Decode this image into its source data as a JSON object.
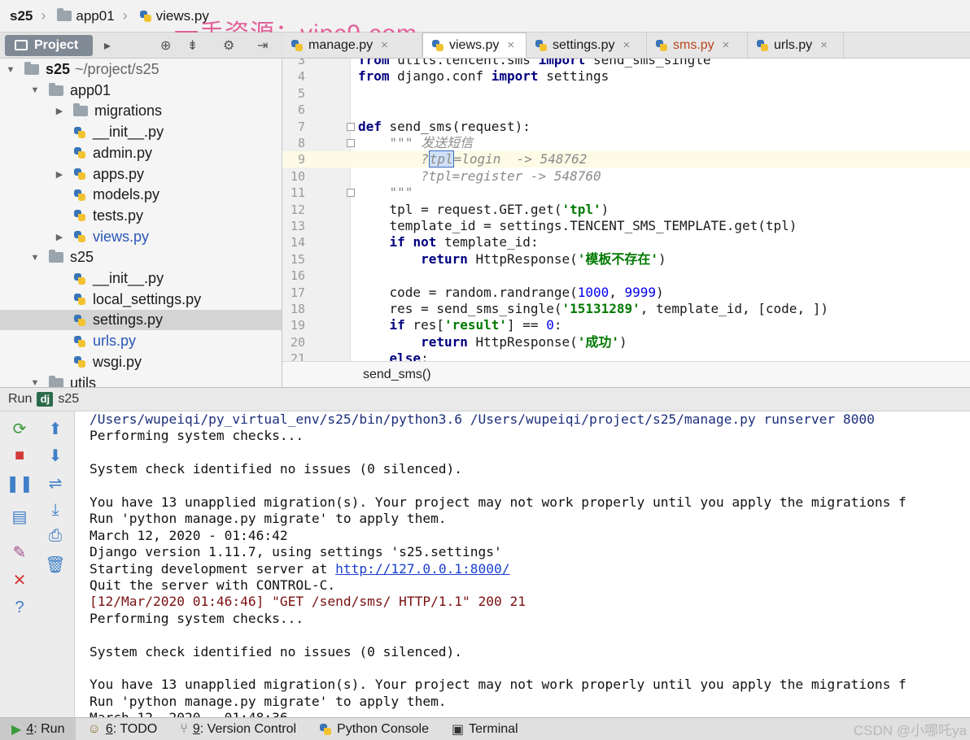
{
  "breadcrumb": {
    "project": "s25",
    "folder": "app01",
    "file": "views.py"
  },
  "watermark": "一手资源：vipc9.com",
  "project_panel": {
    "tab_label": "Project",
    "tree": [
      {
        "label": "s25",
        "sub": "~/project/s25",
        "depth": 0,
        "type": "folder",
        "arrow": "open"
      },
      {
        "label": "app01",
        "depth": 1,
        "type": "folder",
        "arrow": "open"
      },
      {
        "label": "migrations",
        "depth": 2,
        "type": "folder",
        "arrow": "closed"
      },
      {
        "label": "__init__.py",
        "depth": 2,
        "type": "py"
      },
      {
        "label": "admin.py",
        "depth": 2,
        "type": "py"
      },
      {
        "label": "apps.py",
        "depth": 2,
        "type": "py",
        "arrow": "closed"
      },
      {
        "label": "models.py",
        "depth": 2,
        "type": "py"
      },
      {
        "label": "tests.py",
        "depth": 2,
        "type": "py"
      },
      {
        "label": "views.py",
        "depth": 2,
        "type": "py",
        "arrow": "closed",
        "blue": true
      },
      {
        "label": "s25",
        "depth": 1,
        "type": "folder",
        "arrow": "open"
      },
      {
        "label": "__init__.py",
        "depth": 2,
        "type": "py"
      },
      {
        "label": "local_settings.py",
        "depth": 2,
        "type": "py"
      },
      {
        "label": "settings.py",
        "depth": 2,
        "type": "py",
        "selected": true
      },
      {
        "label": "urls.py",
        "depth": 2,
        "type": "py",
        "blue": true
      },
      {
        "label": "wsgi.py",
        "depth": 2,
        "type": "py"
      },
      {
        "label": "utils",
        "depth": 1,
        "type": "folder",
        "arrow": "open"
      }
    ]
  },
  "editor_tabs": [
    {
      "label": "manage.py",
      "active": false
    },
    {
      "label": "views.py",
      "active": true
    },
    {
      "label": "settings.py",
      "active": false
    },
    {
      "label": "sms.py",
      "active": false
    },
    {
      "label": "urls.py",
      "active": false
    }
  ],
  "code": [
    {
      "n": "3",
      "t": "from utils.tencent.sms import send_sms_single"
    },
    {
      "n": "4",
      "t": "from django.conf import settings"
    },
    {
      "n": "5",
      "t": ""
    },
    {
      "n": "6",
      "t": ""
    },
    {
      "n": "7",
      "t": "def send_sms(request):"
    },
    {
      "n": "8",
      "t": "    \"\"\" 发送短信"
    },
    {
      "n": "9",
      "t": "        ?tpl=login  -> 548762"
    },
    {
      "n": "10",
      "t": "        ?tpl=register -> 548760"
    },
    {
      "n": "11",
      "t": "    \"\"\""
    },
    {
      "n": "12",
      "t": "    tpl = request.GET.get('tpl')"
    },
    {
      "n": "13",
      "t": "    template_id = settings.TENCENT_SMS_TEMPLATE.get(tpl)"
    },
    {
      "n": "14",
      "t": "    if not template_id:"
    },
    {
      "n": "15",
      "t": "        return HttpResponse('模板不存在')"
    },
    {
      "n": "16",
      "t": ""
    },
    {
      "n": "17",
      "t": "    code = random.randrange(1000, 9999)"
    },
    {
      "n": "18",
      "t": "    res = send_sms_single('15131289', template_id, [code, ])"
    },
    {
      "n": "19",
      "t": "    if res['result'] == 0:"
    },
    {
      "n": "20",
      "t": "        return HttpResponse('成功')"
    },
    {
      "n": "21",
      "t": "    else:"
    }
  ],
  "editor_breadcrumb": "send_sms()",
  "run": {
    "header_label": "Run",
    "config": "s25",
    "console": [
      {
        "text": "/Users/wupeiqi/py_virtual_env/s25/bin/python3.6 /Users/wupeiqi/project/s25/manage.py runserver 8000",
        "kind": "cmd"
      },
      {
        "text": "Performing system checks...",
        "kind": "out"
      },
      {
        "text": "",
        "kind": "out"
      },
      {
        "text": "System check identified no issues (0 silenced).",
        "kind": "out"
      },
      {
        "text": "",
        "kind": "out"
      },
      {
        "text": "You have 13 unapplied migration(s). Your project may not work properly until you apply the migrations f",
        "kind": "out"
      },
      {
        "text": "Run 'python manage.py migrate' to apply them.",
        "kind": "out"
      },
      {
        "text": "March 12, 2020 - 01:46:42",
        "kind": "out"
      },
      {
        "text": "Django version 1.11.7, using settings 's25.settings'",
        "kind": "out"
      },
      {
        "text": "Starting development server at ",
        "link": "http://127.0.0.1:8000/",
        "kind": "out"
      },
      {
        "text": "Quit the server with CONTROL-C.",
        "kind": "out"
      },
      {
        "text": "[12/Mar/2020 01:46:46] \"GET /send/sms/ HTTP/1.1\" 200 21",
        "kind": "err"
      },
      {
        "text": "Performing system checks...",
        "kind": "out"
      },
      {
        "text": "",
        "kind": "out"
      },
      {
        "text": "System check identified no issues (0 silenced).",
        "kind": "out"
      },
      {
        "text": "",
        "kind": "out"
      },
      {
        "text": "You have 13 unapplied migration(s). Your project may not work properly until you apply the migrations f",
        "kind": "out"
      },
      {
        "text": "Run 'python manage.py migrate' to apply them.",
        "kind": "out"
      },
      {
        "text": "March 12, 2020 - 01:48:36",
        "kind": "out"
      }
    ]
  },
  "bottom_tools": [
    {
      "key": "4",
      "label": ": Run",
      "active": true,
      "icon": "run-icon"
    },
    {
      "key": "6",
      "label": ": TODO",
      "active": false,
      "icon": "todo-icon"
    },
    {
      "key": "9",
      "label": ": Version Control",
      "active": false,
      "icon": "vcs-icon"
    },
    {
      "key": "",
      "label": "Python Console",
      "active": false,
      "icon": "python-console-icon"
    },
    {
      "key": "",
      "label": "Terminal",
      "active": false,
      "icon": "terminal-icon"
    }
  ],
  "csdn_watermark": "CSDN @小哪吒ya",
  "colors": {
    "keyword": "#000080",
    "string": "#007a00",
    "number": "#0000ee",
    "docstring": "#8a8a8a",
    "project_tab": "#7f8a95"
  }
}
